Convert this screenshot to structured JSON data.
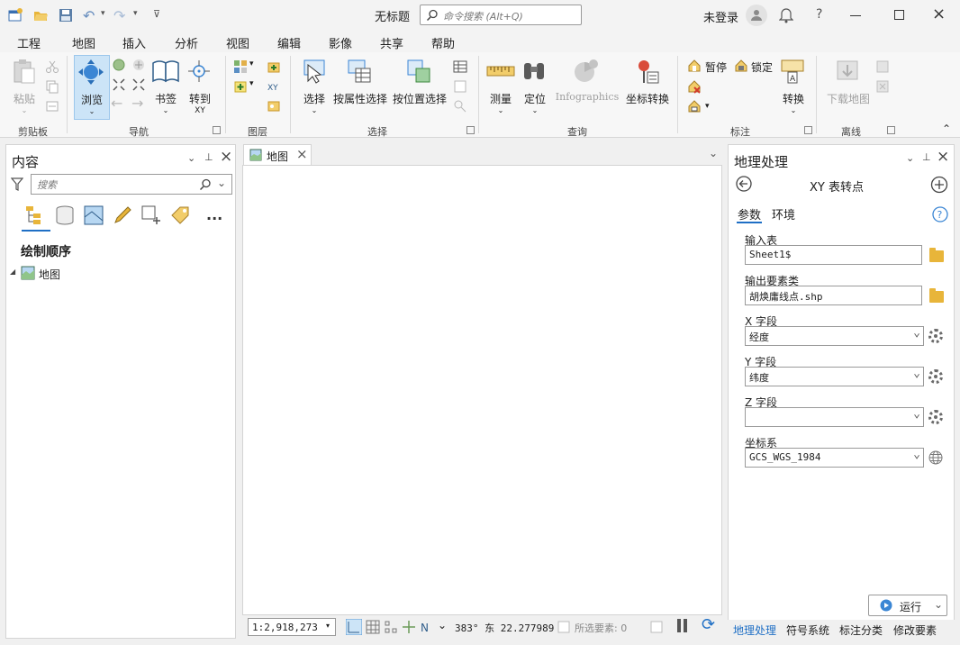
{
  "window": {
    "title": "无标题",
    "search_placeholder": "命令搜索 (Alt+Q)",
    "user": "未登录",
    "help": "?"
  },
  "menu": [
    "工程",
    "地图",
    "插入",
    "分析",
    "视图",
    "编辑",
    "影像",
    "共享",
    "帮助"
  ],
  "menu_active": "地图",
  "ribbon": {
    "clipboard": {
      "paste": "粘贴",
      "label": "剪贴板"
    },
    "navigate": {
      "explore": "浏览",
      "bookmarks": "书签",
      "goto": "转到",
      "goto_sub": "XY",
      "label": "导航"
    },
    "layer": {
      "label": "图层"
    },
    "selection": {
      "select": "选择",
      "by_attr": "按属性选择",
      "by_loc": "按位置选择",
      "label": "选择"
    },
    "inquiry": {
      "measure": "测量",
      "locate": "定位",
      "infographics": "Infographics",
      "convert": "坐标转换",
      "label": "查询"
    },
    "labeling": {
      "pause": "暂停",
      "lock": "锁定",
      "convert": "转换",
      "label": "标注"
    },
    "offline": {
      "download": "下载地图",
      "label": "离线"
    }
  },
  "contents": {
    "title": "内容",
    "search_placeholder": "搜索",
    "heading": "绘制顺序",
    "tree_item": "地图",
    "more": "..."
  },
  "map_tab": {
    "label": "地图"
  },
  "status": {
    "scale": "1:2,918,273",
    "coords": "383° 东  22.277989",
    "selected": "所选要素: 0"
  },
  "geoprocessing": {
    "title": "地理处理",
    "tool": "XY 表转点",
    "tabs": [
      "参数",
      "环境"
    ],
    "fields": [
      {
        "label": "输入表",
        "value": "Sheet1$"
      },
      {
        "label": "输出要素类",
        "value": "胡焕庸线点.shp"
      },
      {
        "label": "X 字段",
        "value": "经度"
      },
      {
        "label": "Y 字段",
        "value": "纬度"
      },
      {
        "label": "Z 字段",
        "value": ""
      },
      {
        "label": "坐标系",
        "value": "GCS_WGS_1984"
      }
    ],
    "run": "运行",
    "bottom_tabs": [
      "地理处理",
      "符号系统",
      "标注分类",
      "修改要素"
    ]
  },
  "colors": {
    "accent": "#1f6fc5",
    "folder": "#e8b53a",
    "selected_bg": "#cce4f7"
  }
}
